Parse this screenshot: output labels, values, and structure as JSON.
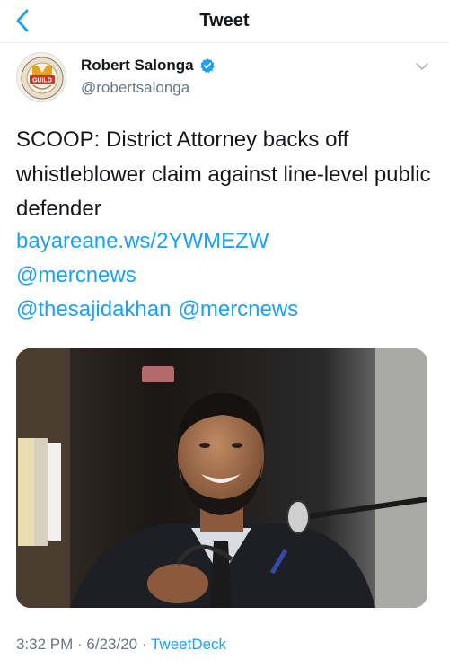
{
  "nav": {
    "title": "Tweet"
  },
  "author": {
    "name": "Robert Salonga",
    "handle": "@robertsalonga",
    "avatar_text": "GUILD"
  },
  "tweet": {
    "text": "SCOOP: District Attorney backs off whistleblower claim against line-level public defender",
    "link": "bayareane.ws/2YWMEZW",
    "mention_1": "@mercnews",
    "mention_2": "@thesajidakhan",
    "mention_3": "@mercnews"
  },
  "footer": {
    "time": "3:32 PM",
    "sep1": " · ",
    "date": "6/23/20",
    "sep2": " · ",
    "app": "TweetDeck"
  },
  "colors": {
    "accent": "#1da1f2",
    "secondary_text": "#657786",
    "verified": "#1da1f2"
  },
  "icons": {
    "back": "chevron-left-icon",
    "verified": "verified-badge-icon",
    "more": "chevron-down-icon"
  }
}
